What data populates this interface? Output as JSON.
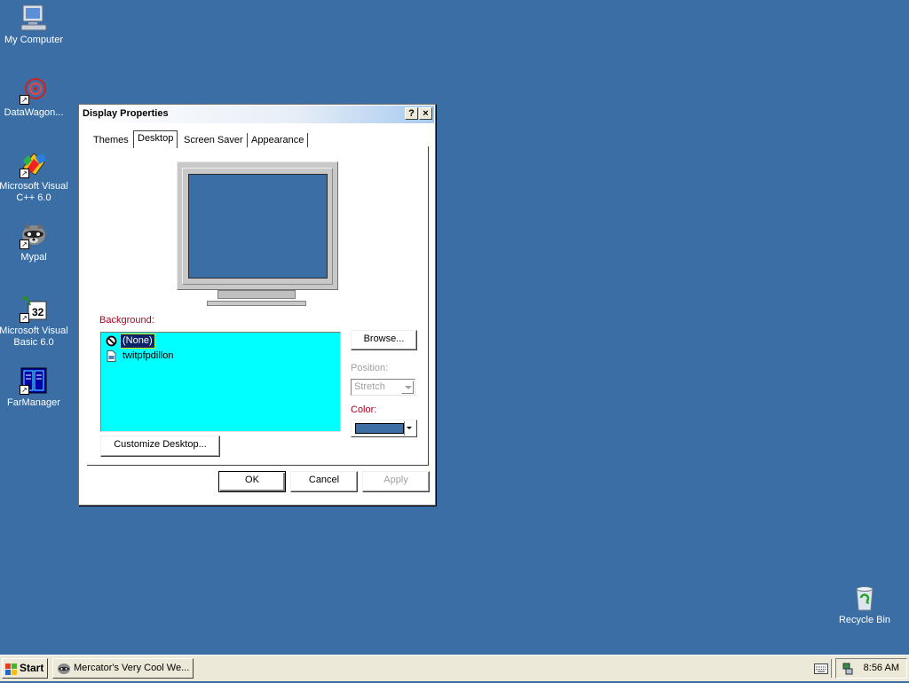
{
  "desktop": {
    "icons": [
      {
        "label": "My Computer",
        "icon": "my-computer-icon"
      },
      {
        "label": "DataWagon...",
        "icon": "datawagon-icon"
      },
      {
        "label": "Microsoft Visual C++ 6.0",
        "icon": "visual-cpp-icon"
      },
      {
        "label": "Mypal",
        "icon": "mypal-raccoon-icon"
      },
      {
        "label": "Microsoft Visual Basic 6.0",
        "icon": "visual-basic-icon"
      },
      {
        "label": "FarManager",
        "icon": "farmanager-icon"
      },
      {
        "label": "Recycle Bin",
        "icon": "recycle-bin-icon"
      }
    ],
    "background_color": "#3a6ea5"
  },
  "dialog": {
    "title": "Display Properties",
    "help_button": "?",
    "close_button": "×",
    "tabs": [
      {
        "label": "Themes",
        "active": false
      },
      {
        "label": "Desktop",
        "active": true
      },
      {
        "label": "Screen Saver",
        "active": false
      },
      {
        "label": "Appearance",
        "active": false
      }
    ],
    "background_label": "Background:",
    "background_items": [
      {
        "label": "(None)",
        "selected": true,
        "icon": "none-icon"
      },
      {
        "label": "twitpfpdillon",
        "selected": false,
        "icon": "image-file-icon"
      }
    ],
    "browse_button": "Browse...",
    "position_label": "Position:",
    "position_value": "Stretch",
    "color_label": "Color:",
    "color_value": "#3a6ea5",
    "customize_button": "Customize Desktop...",
    "ok_button": "OK",
    "cancel_button": "Cancel",
    "apply_button": "Apply"
  },
  "taskbar": {
    "start_label": "Start",
    "task_label": "Mercator's Very Cool We...",
    "clock": "8:56 AM"
  }
}
